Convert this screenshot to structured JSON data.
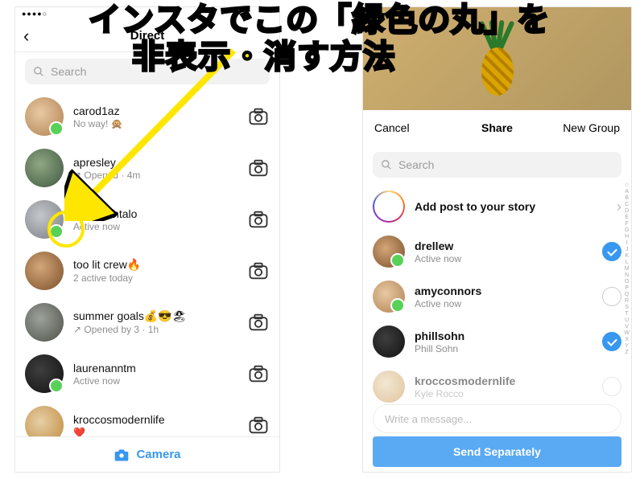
{
  "overlay": {
    "line1": "インスタでこの「緑色の丸」を",
    "line2": "非表示・消す方法"
  },
  "left": {
    "status_signal": "●●●●○",
    "header_title": "Direct",
    "search_placeholder": "Search",
    "rows": [
      {
        "name": "carod1az",
        "sub": "No way! 🙊",
        "dot": true
      },
      {
        "name": "apresley",
        "sub": "↗ Opened · 4m",
        "dot": false
      },
      {
        "name": "anneisantalo",
        "sub": "Active now",
        "dot": true
      },
      {
        "name": "too lit crew🔥",
        "sub": "2 active today",
        "dot": false
      },
      {
        "name": "summer goals💰😎🏖",
        "sub": "↗ Opened by 3 · 1h",
        "dot": false
      },
      {
        "name": "laurenanntm",
        "sub": "Active now",
        "dot": true
      },
      {
        "name": "kroccosmodernlife",
        "sub": "❤️",
        "dot": false
      }
    ],
    "footer": "Camera"
  },
  "right": {
    "cancel": "Cancel",
    "share": "Share",
    "newgroup": "New Group",
    "search_placeholder": "Search",
    "add_story": "Add post to your story",
    "rows": [
      {
        "name": "drellew",
        "sub": "Active now",
        "dot": true,
        "checked": true
      },
      {
        "name": "amyconnors",
        "sub": "Active now",
        "dot": true,
        "checked": false
      },
      {
        "name": "phillsohn",
        "sub": "Phill Sohn",
        "dot": false,
        "checked": true
      },
      {
        "name": "kroccosmodernlife",
        "sub": "Kyle Rocco",
        "dot": false,
        "checked": false
      }
    ],
    "message_placeholder": "Write a message...",
    "send": "Send Separately",
    "alpha": "☆ABCDEFGHIJKLMNOPQRSTUVWXYZ"
  }
}
